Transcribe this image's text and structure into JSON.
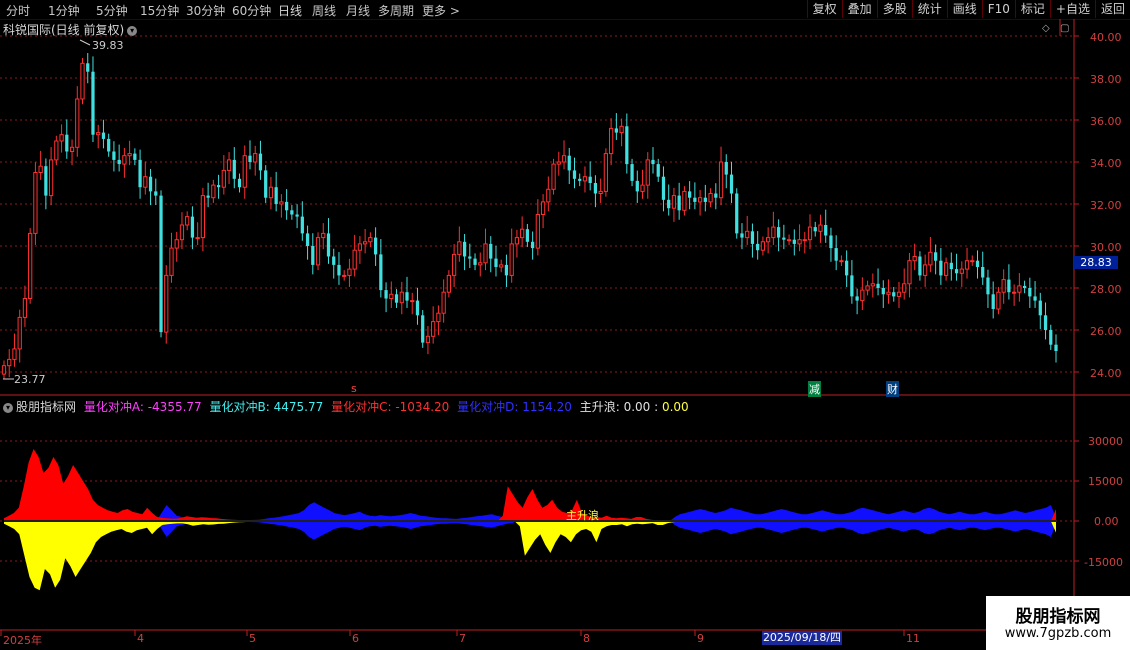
{
  "toolbar": {
    "periods": [
      "分时",
      "1分钟",
      "5分钟",
      "15分钟",
      "30分钟",
      "60分钟",
      "日线",
      "周线",
      "月线",
      "多周期",
      "更多 >"
    ],
    "active_period": "日线",
    "right_buttons": [
      "复权",
      "叠加",
      "多股",
      "统计",
      "画线",
      "F10",
      "标记",
      "+自选",
      "返回"
    ]
  },
  "main_chart": {
    "title": "科锐国际(日线 前复权)",
    "high_label": "39.83",
    "low_label": "23.77",
    "current_price": "28.83",
    "y_ticks": [
      "40.00",
      "38.00",
      "36.00",
      "34.00",
      "32.00",
      "30.00",
      "28.00",
      "26.00",
      "24.00"
    ],
    "annotations": {
      "s": "s",
      "jian": "减",
      "cai": "财"
    }
  },
  "indicator": {
    "name": "股朋指标网",
    "a_label": "量化对冲A:",
    "a_value": "-4355.77",
    "b_label": "量化对冲B:",
    "b_value": "4475.77",
    "c_label": "量化对冲C:",
    "c_value": "-1034.20",
    "d_label": "量化对冲D:",
    "d_value": "1154.20",
    "e_label": "主升浪:",
    "e_value": "0.00",
    "e_value2": "0.00",
    "marker_text": "主升浪",
    "y_ticks": [
      "30000",
      "15000",
      "0.00",
      "-15000"
    ]
  },
  "x_axis": {
    "labels": [
      "2025年",
      "4",
      "5",
      "6",
      "7",
      "8",
      "9",
      "11"
    ],
    "cursor_date": "2025/09/18/四"
  },
  "watermark": {
    "line1": "股朋指标网",
    "line2": "www.7gpzb.com"
  },
  "colors": {
    "up": "#ff3030",
    "down": "#40e0e0",
    "red_area": "#ff0000",
    "yellow_area": "#ffff00",
    "blue_area": "#1010ff",
    "grid": "#8a1a1a",
    "axis": "#c02020"
  },
  "chart_data": [
    {
      "type": "candlestick",
      "title": "科锐国际(日线 前复权)",
      "ylim": [
        23.5,
        40.5
      ],
      "close": [
        24.3,
        24.6,
        25.1,
        26.6,
        27.5,
        30.6,
        33.5,
        33.8,
        32.4,
        34.1,
        35.0,
        35.3,
        34.5,
        34.7,
        37.0,
        38.7,
        38.3,
        35.3,
        35.4,
        35.1,
        34.5,
        34.1,
        33.9,
        34.3,
        34.4,
        34.1,
        32.8,
        33.3,
        32.6,
        32.4,
        25.9,
        28.6,
        29.9,
        30.3,
        31.0,
        31.4,
        30.4,
        30.4,
        32.4,
        32.3,
        32.9,
        32.8,
        33.6,
        34.1,
        33.2,
        32.8,
        34.3,
        34.0,
        34.4,
        33.6,
        32.3,
        32.8,
        32.0,
        32.1,
        31.7,
        31.5,
        31.4,
        30.6,
        30.0,
        29.1,
        30.4,
        30.6,
        29.5,
        29.1,
        28.6,
        28.6,
        28.9,
        29.8,
        30.1,
        30.2,
        30.4,
        29.6,
        27.9,
        27.5,
        27.7,
        27.3,
        27.8,
        27.4,
        27.4,
        26.7,
        25.4,
        25.7,
        26.4,
        26.8,
        27.8,
        28.6,
        29.6,
        30.2,
        29.5,
        29.4,
        29.1,
        29.2,
        30.1,
        29.4,
        29.0,
        29.1,
        28.6,
        30.1,
        30.4,
        30.8,
        30.2,
        29.9,
        31.5,
        32.1,
        32.7,
        33.9,
        34.0,
        34.3,
        33.6,
        33.2,
        33.1,
        33.3,
        33.0,
        32.5,
        32.6,
        34.4,
        35.6,
        35.4,
        35.7,
        33.9,
        33.1,
        32.6,
        32.9,
        34.1,
        33.9,
        33.3,
        32.2,
        31.8,
        32.4,
        31.7,
        32.6,
        32.3,
        32.1,
        32.3,
        32.1,
        32.5,
        32.3,
        34.0,
        33.4,
        32.5,
        30.6,
        30.4,
        30.7,
        30.1,
        29.8,
        30.2,
        30.4,
        30.9,
        30.4,
        30.3,
        30.3,
        30.1,
        30.3,
        30.3,
        30.9,
        30.7,
        31.0,
        30.5,
        29.9,
        29.3,
        29.3,
        28.6,
        27.6,
        27.4,
        27.9,
        28.1,
        28.2,
        28.0,
        27.7,
        27.8,
        27.6,
        27.8,
        28.2,
        29.3,
        29.5,
        28.6,
        29.1,
        29.7,
        29.3,
        28.6,
        29.2,
        28.9,
        28.7,
        28.9,
        29.3,
        29.3,
        29.0,
        28.5,
        27.7,
        27.0,
        27.8,
        28.4,
        27.8,
        27.8,
        28.1,
        28.0,
        27.6,
        27.4,
        26.7,
        26.0,
        25.3,
        25.0
      ]
    },
    {
      "type": "area",
      "title": "股朋指标网",
      "ylim": [
        -27000,
        27000
      ],
      "series": [
        {
          "name": "量化对冲A",
          "values": [
            -1000,
            -2000,
            -3000,
            -5000,
            -13000,
            -21000,
            -25000,
            -26000,
            -18000,
            -20000,
            -25000,
            -22000,
            -14000,
            -17000,
            -21000,
            -18000,
            -15000,
            -12000,
            -8000,
            -6000,
            -5000,
            -4000,
            -3500,
            -3000,
            -4000,
            -4500,
            -3500,
            -3000,
            -2500,
            -5000,
            -3000,
            -1500,
            -1200,
            -1000,
            -900,
            -900,
            -1200,
            -1800,
            -1500,
            -1200,
            -1400,
            -1300,
            -1100,
            -1000,
            -800,
            -600,
            -500,
            -400,
            -300,
            -200,
            -200,
            -150,
            -100,
            -100,
            -100,
            -100,
            -100,
            -100,
            -100,
            -100,
            -100,
            -100,
            -100,
            -100,
            -100,
            -100,
            -100,
            -100,
            -100,
            -100,
            -100,
            -100,
            -100,
            -100,
            -100,
            -100,
            -100,
            -100,
            -100,
            -100,
            -100,
            -100,
            -100,
            -100,
            -100,
            -100,
            -100,
            -100,
            -100,
            -100,
            -100,
            -100,
            -100,
            -100,
            -100,
            -100,
            -100,
            -100,
            -100,
            -100,
            -100,
            -2000,
            -13000,
            -10000,
            -7000,
            -5000,
            -9000,
            -12000,
            -8000,
            -5000,
            -6000,
            -8000,
            -5000,
            -3500,
            -3000,
            -4000,
            -8000,
            -3000,
            -2000,
            -1500,
            -1500,
            -1200,
            -2000,
            -1200,
            -1000,
            -1200,
            -1000,
            -800,
            -1500,
            -1500,
            -800,
            -500,
            -300,
            -200,
            -100,
            -100,
            -100,
            -100,
            -100,
            -100,
            -100,
            -100,
            -100,
            -100,
            -100,
            -100,
            -100,
            -100,
            -100,
            -100,
            -100,
            -100,
            -100,
            -100,
            -100,
            -100,
            -100,
            -100,
            -100,
            -100,
            -100,
            -100,
            -100,
            -100,
            -100,
            -100,
            -100,
            -100,
            -100,
            -100,
            -100,
            -100,
            -100,
            -100,
            -100,
            -100,
            -100,
            -100,
            -100,
            -100,
            -100,
            -100,
            -100,
            -100,
            -100,
            -100,
            -100,
            -100,
            -100,
            -100,
            -100,
            -100,
            -100,
            -100,
            -100,
            -100,
            -100,
            -100,
            -100,
            -100,
            -100,
            -100,
            -100,
            -100,
            -100,
            -100,
            -4355.77
          ]
        },
        {
          "name": "量化对冲B",
          "values": [
            1000,
            2000,
            3000,
            5000,
            13000,
            22000,
            27000,
            24000,
            18000,
            20000,
            24000,
            21000,
            14000,
            17000,
            21000,
            18000,
            15000,
            12000,
            8000,
            6000,
            5000,
            4000,
            3500,
            3000,
            4000,
            4500,
            3500,
            3000,
            2500,
            5000,
            3000,
            1500,
            1200,
            1000,
            900,
            900,
            1200,
            1800,
            1500,
            1200,
            1400,
            1300,
            1100,
            1000,
            800,
            600,
            500,
            400,
            300,
            200,
            200,
            150,
            100,
            100,
            100,
            100,
            100,
            100,
            100,
            100,
            100,
            100,
            100,
            100,
            100,
            100,
            100,
            100,
            100,
            100,
            100,
            100,
            100,
            100,
            100,
            100,
            100,
            100,
            100,
            100,
            100,
            100,
            100,
            100,
            100,
            100,
            100,
            100,
            100,
            100,
            100,
            100,
            100,
            100,
            100,
            100,
            100,
            100,
            100,
            100,
            100,
            2000,
            13000,
            10000,
            7000,
            5000,
            9000,
            12000,
            8000,
            5000,
            6000,
            8000,
            5000,
            3500,
            3000,
            4000,
            8000,
            3000,
            2000,
            1500,
            1500,
            1200,
            2000,
            1200,
            1000,
            1200,
            1000,
            800,
            1500,
            1500,
            800,
            500,
            300,
            200,
            100,
            100,
            100,
            100,
            100,
            100,
            100,
            100,
            100,
            100,
            100,
            100,
            100,
            100,
            100,
            100,
            100,
            100,
            100,
            100,
            100,
            100,
            100,
            100,
            100,
            100,
            100,
            100,
            100,
            100,
            100,
            100,
            100,
            100,
            100,
            100,
            100,
            100,
            100,
            100,
            100,
            100,
            100,
            100,
            100,
            100,
            100,
            100,
            100,
            100,
            100,
            100,
            100,
            100,
            100,
            100,
            100,
            100,
            100,
            100,
            100,
            100,
            100,
            100,
            100,
            100,
            100,
            100,
            100,
            100,
            100,
            100,
            100,
            100,
            100,
            100,
            100,
            100,
            100,
            4475.77
          ]
        },
        {
          "name": "量化对冲C",
          "values": [
            0,
            0,
            0,
            0,
            0,
            0,
            0,
            0,
            0,
            0,
            0,
            0,
            0,
            0,
            0,
            0,
            0,
            0,
            0,
            0,
            0,
            0,
            0,
            0,
            0,
            0,
            0,
            0,
            0,
            0,
            0,
            -3000,
            -6000,
            -4000,
            -2000,
            -1500,
            -1000,
            -1000,
            -800,
            -700,
            -600,
            -500,
            -500,
            -500,
            -500,
            -400,
            -300,
            -300,
            -300,
            -400,
            -500,
            -700,
            -1000,
            -1200,
            -1500,
            -1800,
            -2200,
            -2500,
            -3000,
            -4000,
            -6000,
            -7000,
            -6000,
            -5000,
            -4000,
            -3000,
            -2500,
            -2200,
            -2500,
            -3000,
            -3500,
            -2500,
            -2000,
            -1800,
            -2200,
            -2000,
            -1800,
            -2000,
            -2200,
            -2500,
            -3000,
            -2500,
            -2000,
            -1800,
            -1500,
            -1200,
            -1000,
            -1000,
            -900,
            -800,
            -1000,
            -1200,
            -1500,
            -1800,
            -2000,
            -2300,
            -2500,
            -2000,
            -1500,
            -1000,
            -800,
            0,
            0,
            0,
            0,
            0,
            0,
            0,
            0,
            0,
            0,
            0,
            0,
            0,
            0,
            0,
            0,
            0,
            0,
            0,
            0,
            0,
            0,
            0,
            0,
            0,
            0,
            0,
            0,
            0,
            0,
            0,
            -1500,
            -2500,
            -3000,
            -3500,
            -4000,
            -4500,
            -4000,
            -3500,
            -3000,
            -3500,
            -4000,
            -5000,
            -4500,
            -4000,
            -3500,
            -3000,
            -2500,
            -2500,
            -3000,
            -3500,
            -4000,
            -4500,
            -4000,
            -3500,
            -3000,
            -2500,
            -2500,
            -3000,
            -3500,
            -4000,
            -3500,
            -3000,
            -2500,
            -2500,
            -3000,
            -3500,
            -4500,
            -5000,
            -4500,
            -4000,
            -3500,
            -3000,
            -2500,
            -3000,
            -3500,
            -4000,
            -3500,
            -3000,
            -3500,
            -4500,
            -5000,
            -4500,
            -3500,
            -3000,
            -2500,
            -3000,
            -3500,
            -3000,
            -2500,
            -2500,
            -3000,
            -3500,
            -3000,
            -2500,
            -2500,
            -3000,
            -3500,
            -4000,
            -3500,
            -3000,
            -3500,
            -4000,
            -4500,
            -5000,
            -6000,
            -1034.2
          ]
        },
        {
          "name": "量化对冲D",
          "values": [
            0,
            0,
            0,
            0,
            0,
            0,
            0,
            0,
            0,
            0,
            0,
            0,
            0,
            0,
            0,
            0,
            0,
            0,
            0,
            0,
            0,
            0,
            0,
            0,
            0,
            0,
            0,
            0,
            0,
            0,
            0,
            3000,
            6000,
            4000,
            2000,
            1500,
            1000,
            1000,
            800,
            700,
            600,
            500,
            500,
            500,
            500,
            400,
            300,
            300,
            300,
            400,
            500,
            700,
            1000,
            1200,
            1500,
            1800,
            2200,
            2500,
            3000,
            4000,
            6000,
            7000,
            6000,
            5000,
            4000,
            3000,
            2500,
            2200,
            2500,
            3000,
            3500,
            2500,
            2000,
            1800,
            2200,
            2000,
            1800,
            2000,
            2200,
            2500,
            3000,
            2500,
            2000,
            1800,
            1500,
            1200,
            1000,
            1000,
            900,
            800,
            1000,
            1200,
            1500,
            1800,
            2000,
            2300,
            2500,
            2000,
            1500,
            1000,
            800,
            0,
            0,
            0,
            0,
            0,
            0,
            0,
            0,
            0,
            0,
            0,
            0,
            0,
            0,
            0,
            0,
            0,
            0,
            0,
            0,
            0,
            0,
            0,
            0,
            0,
            0,
            0,
            0,
            0,
            0,
            0,
            1500,
            2500,
            3000,
            3500,
            4000,
            4500,
            4000,
            3500,
            3000,
            3500,
            4000,
            5000,
            4500,
            4000,
            3500,
            3000,
            2500,
            2500,
            3000,
            3500,
            4000,
            4500,
            4000,
            3500,
            3000,
            2500,
            2500,
            3000,
            3500,
            4000,
            3500,
            3000,
            2500,
            2500,
            3000,
            3500,
            4500,
            5000,
            4500,
            4000,
            3500,
            3000,
            2500,
            3000,
            3500,
            4000,
            3500,
            3000,
            3500,
            4500,
            5000,
            4500,
            3500,
            3000,
            2500,
            3000,
            3500,
            3000,
            2500,
            2500,
            3000,
            3500,
            3000,
            2500,
            2500,
            3000,
            3500,
            4000,
            3500,
            3000,
            3500,
            4000,
            4500,
            5000,
            6000,
            1154.2
          ]
        },
        {
          "name": "主升浪",
          "values": [
            0
          ]
        }
      ]
    }
  ]
}
